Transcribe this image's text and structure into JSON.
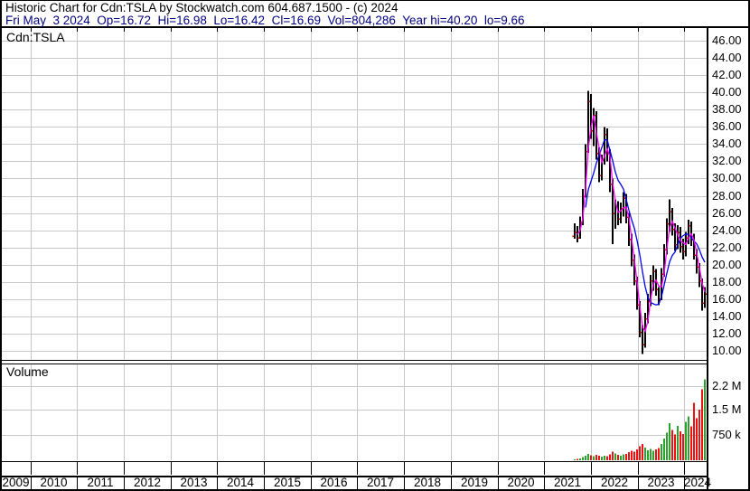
{
  "header": {
    "line1": "Historic Chart for Cdn:TSLA by Stockwatch.com 604.687.1500 - (c) 2024",
    "line2": "Fri May  3 2024  Op=16.72  Hi=16.98  Lo=16.42  Cl=16.69  Vol=804,286  Year hi=40.20  lo=9.66"
  },
  "price_pane": {
    "symbol_label": "Cdn:TSLA"
  },
  "volume_pane": {
    "label": "Volume"
  },
  "axes": {
    "price_labels": [
      "46.00",
      "44.00",
      "42.00",
      "40.00",
      "38.00",
      "36.00",
      "34.00",
      "32.00",
      "30.00",
      "28.00",
      "26.00",
      "24.00",
      "22.00",
      "20.00",
      "18.00",
      "16.00",
      "14.00",
      "12.00",
      "10.00"
    ],
    "volume_labels": [
      {
        "text": "2.2 M",
        "value_k": 2200
      },
      {
        "text": "1.5 M",
        "value_k": 1500
      },
      {
        "text": "750 k",
        "value_k": 750
      }
    ],
    "years": [
      "2009",
      "2010",
      "2011",
      "2012",
      "2013",
      "2014",
      "2015",
      "2016",
      "2017",
      "2018",
      "2019",
      "2020",
      "2021",
      "2022",
      "2023",
      "2024"
    ]
  },
  "colors": {
    "grid": "#c8c8c8",
    "frame": "#000000",
    "bar": "#000000",
    "tick": "#ee0000",
    "ma_fast": "#ff00ff",
    "ma_slow": "#0000ee",
    "vol_up": "#2aa32a",
    "vol_down": "#ee1111",
    "header2": "#000080"
  },
  "chart_data": {
    "type": "ohlc+volume",
    "title": "Historic Chart for Cdn:TSLA",
    "symbol": "Cdn:TSLA",
    "frequency": "weekly",
    "x_axis_years": [
      "2009",
      "2010",
      "2011",
      "2012",
      "2013",
      "2014",
      "2015",
      "2016",
      "2017",
      "2018",
      "2019",
      "2020",
      "2021",
      "2022",
      "2023",
      "2024"
    ],
    "data_span": "mid-2021 to 2024-05-03",
    "price_axis_range": [
      10,
      46
    ],
    "volume_axis_ticks_k": [
      750,
      1500,
      2200
    ],
    "year_high": 40.2,
    "year_low": 9.66,
    "last": {
      "open": 16.72,
      "high": 16.98,
      "low": 16.42,
      "close": 16.69,
      "volume": "804,286"
    },
    "grid": true,
    "bars_hlc": [
      [
        24.8,
        23.0,
        23.8
      ],
      [
        24.5,
        22.6,
        23.2
      ],
      [
        25.6,
        23.0,
        25.0
      ],
      [
        28.8,
        24.6,
        28.0
      ],
      [
        34.0,
        27.8,
        33.2
      ],
      [
        40.2,
        33.0,
        39.0
      ],
      [
        39.8,
        34.6,
        35.6
      ],
      [
        38.2,
        33.8,
        37.4
      ],
      [
        37.8,
        32.2,
        33.0
      ],
      [
        33.6,
        29.6,
        30.4
      ],
      [
        32.8,
        29.8,
        32.2
      ],
      [
        36.0,
        31.6,
        35.2
      ],
      [
        35.8,
        32.0,
        33.0
      ],
      [
        33.4,
        28.4,
        29.4
      ],
      [
        30.0,
        22.4,
        26.0
      ],
      [
        27.6,
        24.2,
        26.8
      ],
      [
        27.4,
        24.6,
        25.4
      ],
      [
        27.2,
        24.8,
        26.6
      ],
      [
        28.4,
        25.6,
        27.8
      ],
      [
        28.2,
        24.8,
        25.6
      ],
      [
        26.0,
        22.2,
        23.0
      ],
      [
        23.6,
        19.8,
        20.6
      ],
      [
        21.2,
        17.6,
        18.2
      ],
      [
        18.6,
        14.8,
        15.4
      ],
      [
        15.8,
        11.6,
        12.2
      ],
      [
        13.0,
        9.66,
        10.8
      ],
      [
        14.4,
        10.4,
        13.8
      ],
      [
        16.6,
        13.2,
        15.8
      ],
      [
        18.8,
        15.2,
        18.2
      ],
      [
        19.9,
        17.0,
        19.3
      ],
      [
        19.5,
        16.4,
        17.2
      ],
      [
        17.4,
        15.3,
        16.1
      ],
      [
        19.6,
        15.9,
        19.0
      ],
      [
        22.4,
        18.6,
        21.8
      ],
      [
        25.4,
        21.2,
        24.8
      ],
      [
        27.6,
        23.8,
        26.2
      ],
      [
        26.6,
        23.4,
        24.2
      ],
      [
        24.8,
        21.6,
        22.4
      ],
      [
        24.6,
        21.8,
        23.8
      ],
      [
        24.4,
        21.4,
        22.2
      ],
      [
        23.0,
        20.6,
        21.6
      ],
      [
        23.8,
        21.0,
        23.2
      ],
      [
        25.2,
        22.4,
        24.6
      ],
      [
        25.0,
        22.2,
        23.0
      ],
      [
        23.6,
        20.6,
        21.2
      ],
      [
        21.8,
        19.0,
        19.8
      ],
      [
        20.2,
        17.4,
        18.2
      ],
      [
        18.4,
        14.7,
        15.6
      ],
      [
        17.4,
        15.0,
        16.69
      ]
    ],
    "volumes_k": [
      25,
      40,
      55,
      90,
      140,
      190,
      150,
      120,
      160,
      130,
      110,
      140,
      120,
      180,
      260,
      200,
      160,
      140,
      170,
      190,
      240,
      280,
      260,
      320,
      420,
      480,
      380,
      300,
      340,
      280,
      320,
      360,
      480,
      640,
      820,
      1100,
      900,
      760,
      1020,
      860,
      780,
      1140,
      1300,
      1000,
      1700,
      1250,
      1500,
      2100,
      2400
    ],
    "moving_averages": {
      "fast_window": 3,
      "slow_window": 8
    }
  }
}
